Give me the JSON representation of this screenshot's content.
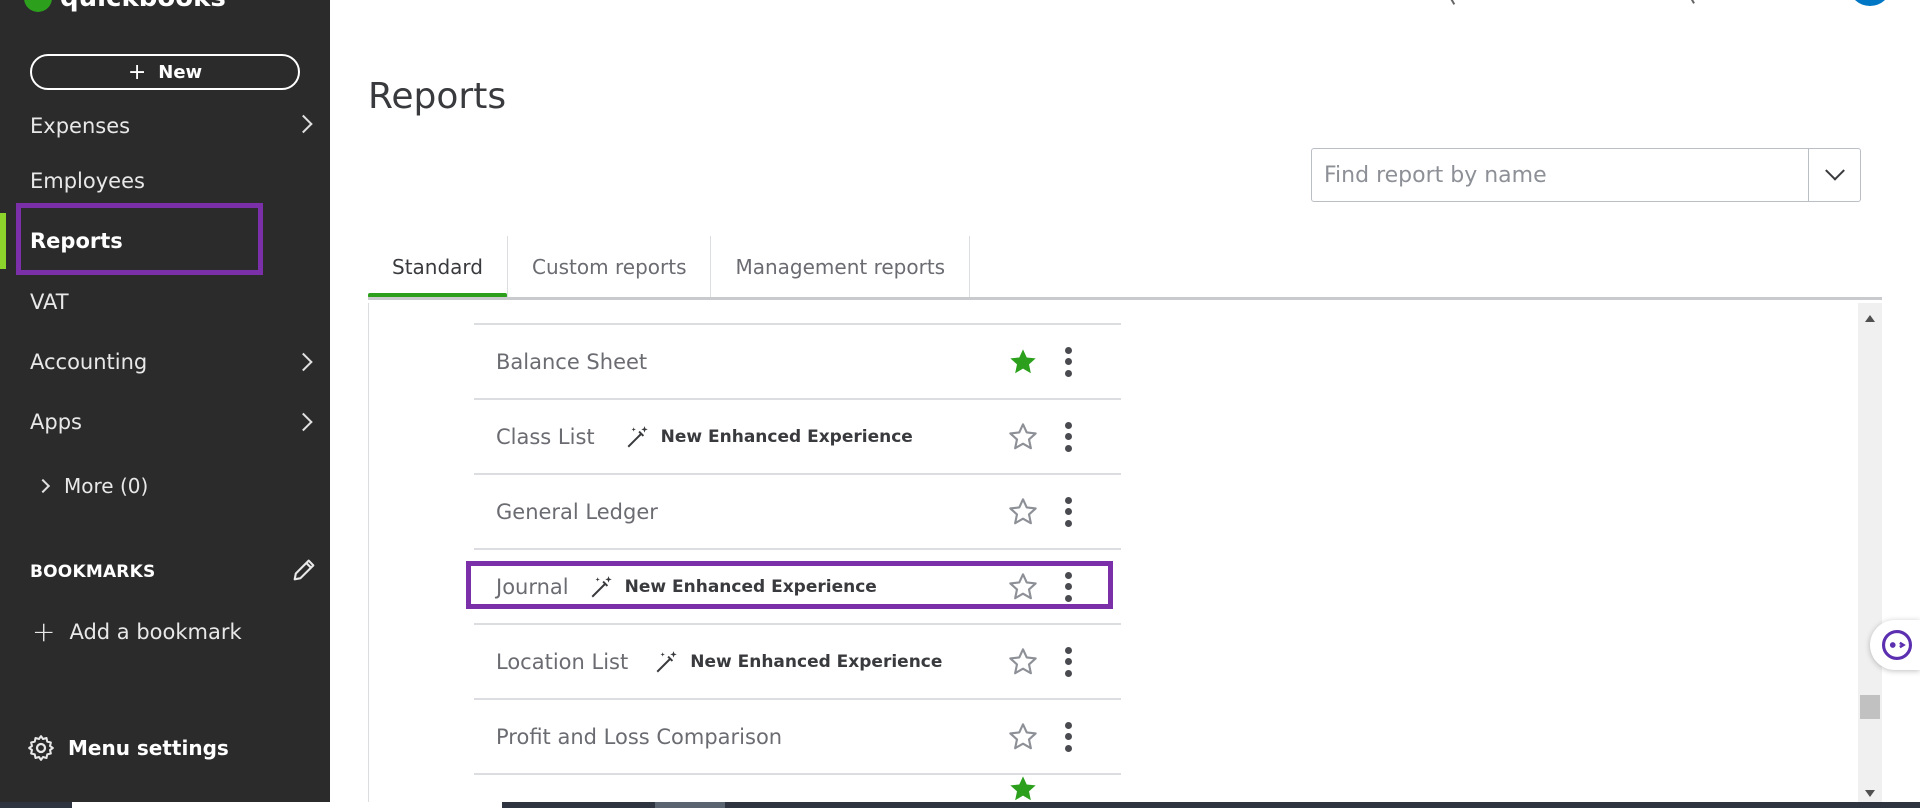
{
  "sidebar": {
    "logo_text": "quickbooks",
    "new_label": "New",
    "new_plus": "+",
    "items": [
      {
        "label": "Expenses"
      },
      {
        "label": "Employees"
      },
      {
        "label": "Reports"
      },
      {
        "label": "VAT"
      },
      {
        "label": "Accounting"
      },
      {
        "label": "Apps"
      }
    ],
    "more_label": "More (0)",
    "bookmarks_heading": "BOOKMARKS",
    "add_bookmark_label": "Add a bookmark",
    "add_bookmark_plus": "+",
    "menu_settings_label": "Menu settings"
  },
  "main": {
    "page_title": "Reports",
    "search": {
      "placeholder": "Find report by name"
    },
    "tabs": [
      {
        "label": "Standard"
      },
      {
        "label": "Custom reports"
      },
      {
        "label": "Management reports"
      }
    ],
    "reports": [
      {
        "name": "Balance Sheet",
        "enhanced": "",
        "favorite": true
      },
      {
        "name": "Class List",
        "enhanced": "New Enhanced Experience",
        "favorite": false
      },
      {
        "name": "General Ledger",
        "enhanced": "",
        "favorite": false
      },
      {
        "name": "Journal",
        "enhanced": "New Enhanced Experience",
        "favorite": false
      },
      {
        "name": "Location List",
        "enhanced": "New Enhanced Experience",
        "favorite": false
      },
      {
        "name": "Profit and Loss Comparison",
        "enhanced": "",
        "favorite": false
      }
    ]
  },
  "colors": {
    "sidebar_bg": "#2b2b2b",
    "accent_green": "#2ca01c",
    "active_bar": "#8cd32c",
    "highlight_purple": "#7b2fa8",
    "avatar_blue": "#0077c5"
  },
  "icons": {
    "star_filled": "star-filled-icon",
    "star_outline": "star-outline-icon",
    "magic_wand": "magic-wand-icon",
    "kebab": "more-vertical-icon",
    "gear": "gear-icon",
    "pencil": "pencil-icon"
  }
}
